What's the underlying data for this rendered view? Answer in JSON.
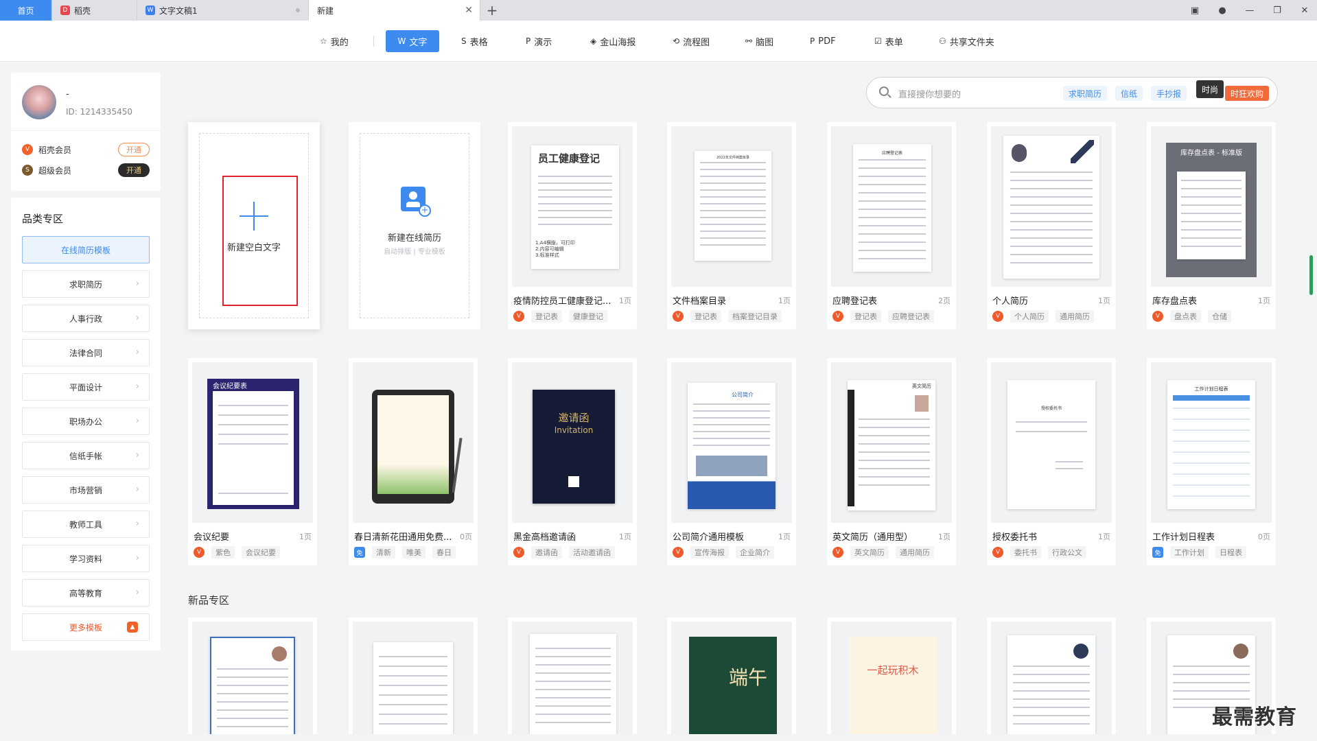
{
  "tabs": {
    "home": "首页",
    "t1": "稻壳",
    "t2": "文字文稿1",
    "t3": "新建",
    "add": "+"
  },
  "nav": [
    {
      "label": "我的",
      "icon": "☆"
    },
    {
      "label": "文字",
      "icon": "W"
    },
    {
      "label": "表格",
      "icon": "S"
    },
    {
      "label": "演示",
      "icon": "P"
    },
    {
      "label": "金山海报",
      "icon": "◈"
    },
    {
      "label": "流程图",
      "icon": "⟲"
    },
    {
      "label": "脑图",
      "icon": "⚯"
    },
    {
      "label": "PDF",
      "icon": "P"
    },
    {
      "label": "表单",
      "icon": "☑"
    },
    {
      "label": "共享文件夹",
      "icon": "⚇"
    }
  ],
  "user": {
    "name": "-",
    "id": "ID: 1214335450",
    "member1": "稻壳会员",
    "member1_btn": "开通",
    "member2": "超级会员",
    "member2_btn": "开通"
  },
  "categories": {
    "title": "品类专区",
    "items": [
      "在线简历模板",
      "求职简历",
      "人事行政",
      "法律合同",
      "平面设计",
      "职场办公",
      "信纸手帐",
      "市场营销",
      "教师工具",
      "学习资料",
      "高等教育",
      "更多模板"
    ]
  },
  "search": {
    "placeholder": "直接搜你想要的",
    "tags": [
      "求职简历",
      "信纸",
      "手抄报",
      "时尚",
      "时狂欢购"
    ]
  },
  "new_blank": "新建空白文字",
  "new_resume": {
    "title": "新建在线简历",
    "sub": "自动排版 | 专业模板"
  },
  "thumb_texts": {
    "t1": "员工健康登记",
    "t1_notes": [
      "1.A4横版，可打印",
      "2.内容可编辑",
      "3.标准样式"
    ],
    "t2": "2022年文件档案目录",
    "t3": "应聘登记表",
    "t6": "库存盘点表 - 标准版",
    "t7": "会议纪要表",
    "t9_a": "邀请函",
    "t9_b": "Invitation",
    "t10": "公司简介",
    "t11": "英文简历",
    "t12": "授权委托书",
    "t13": "工作计划日程表",
    "t17": "端午",
    "t18": "一起玩积木"
  },
  "templates_row1": [
    {
      "title": "疫情防控员工健康登记...",
      "pages": "1页",
      "badge": "V",
      "tags": [
        "登记表",
        "健康登记"
      ]
    },
    {
      "title": "文件档案目录",
      "pages": "1页",
      "badge": "V",
      "tags": [
        "登记表",
        "档案登记目录"
      ]
    },
    {
      "title": "应聘登记表",
      "pages": "2页",
      "badge": "V",
      "tags": [
        "登记表",
        "应聘登记表"
      ]
    },
    {
      "title": "个人简历",
      "pages": "1页",
      "badge": "V",
      "tags": [
        "个人简历",
        "通用简历"
      ]
    },
    {
      "title": "库存盘点表",
      "pages": "1页",
      "badge": "V",
      "tags": [
        "盘点表",
        "仓储"
      ]
    }
  ],
  "templates_row2": [
    {
      "title": "会议纪要",
      "pages": "1页",
      "badge": "V",
      "tags": [
        "紫色",
        "会议纪要"
      ]
    },
    {
      "title": "春日清新花田通用免费...",
      "pages": "0页",
      "badge": "免",
      "tags": [
        "清新",
        "唯美",
        "春日"
      ]
    },
    {
      "title": "黑金高档邀请函",
      "pages": "1页",
      "badge": "V",
      "tags": [
        "邀请函",
        "活动邀请函"
      ]
    },
    {
      "title": "公司简介通用模板",
      "pages": "1页",
      "badge": "V",
      "tags": [
        "宣传海报",
        "企业简介"
      ]
    },
    {
      "title": "英文简历（通用型）",
      "pages": "1页",
      "badge": "V",
      "tags": [
        "英文简历",
        "通用简历"
      ]
    },
    {
      "title": "授权委托书",
      "pages": "1页",
      "badge": "V",
      "tags": [
        "委托书",
        "行政公文"
      ]
    },
    {
      "title": "工作计划日程表",
      "pages": "0页",
      "badge": "免",
      "tags": [
        "工作计划",
        "日程表"
      ]
    }
  ],
  "new_section": "新品专区",
  "watermark": "最需教育",
  "colors": {
    "accent": "#3d8bef",
    "orange": "#f05a2b",
    "red_box": "#e0232a"
  }
}
